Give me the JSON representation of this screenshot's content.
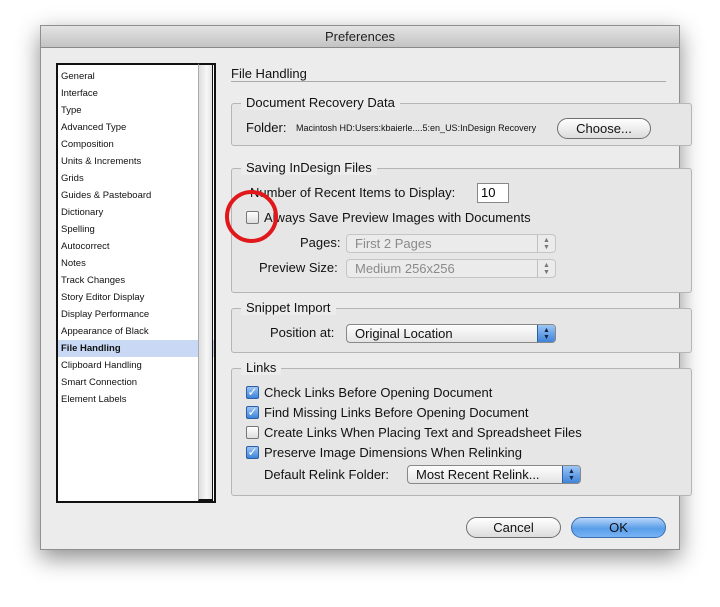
{
  "window": {
    "title": "Preferences"
  },
  "sidebar": {
    "items": [
      {
        "label": "General"
      },
      {
        "label": "Interface"
      },
      {
        "label": "Type"
      },
      {
        "label": "Advanced Type"
      },
      {
        "label": "Composition"
      },
      {
        "label": "Units & Increments"
      },
      {
        "label": "Grids"
      },
      {
        "label": "Guides & Pasteboard"
      },
      {
        "label": "Dictionary"
      },
      {
        "label": "Spelling"
      },
      {
        "label": "Autocorrect"
      },
      {
        "label": "Notes"
      },
      {
        "label": "Track Changes"
      },
      {
        "label": "Story Editor Display"
      },
      {
        "label": "Display Performance"
      },
      {
        "label": "Appearance of Black"
      },
      {
        "label": "File Handling"
      },
      {
        "label": "Clipboard Handling"
      },
      {
        "label": "Smart Connection"
      },
      {
        "label": "Element Labels"
      }
    ],
    "selected": "File Handling"
  },
  "section_title": "File Handling",
  "recovery": {
    "label": "Document Recovery Data",
    "folder_label": "Folder:",
    "folder_path": "Macintosh HD:Users:kbaierle....5:en_US:InDesign Recovery",
    "choose_label": "Choose..."
  },
  "saving": {
    "label": "Saving InDesign Files",
    "recent_label": "Number of Recent Items to Display:",
    "recent_value": "10",
    "preview_label": "Always Save Preview Images with Documents",
    "preview_checked": false,
    "pages_label": "Pages:",
    "pages_value": "First 2 Pages",
    "size_label": "Preview Size:",
    "size_value": "Medium 256x256"
  },
  "snippet": {
    "label": "Snippet Import",
    "position_label": "Position at:",
    "position_value": "Original Location"
  },
  "links": {
    "label": "Links",
    "options": [
      {
        "label": "Check Links Before Opening Document",
        "checked": true
      },
      {
        "label": "Find Missing Links Before Opening Document",
        "checked": true
      },
      {
        "label": "Create Links When Placing Text and Spreadsheet Files",
        "checked": false
      },
      {
        "label": "Preserve Image Dimensions When Relinking",
        "checked": true
      }
    ],
    "relink_label": "Default Relink Folder:",
    "relink_value": "Most Recent Relink..."
  },
  "buttons": {
    "cancel": "Cancel",
    "ok": "OK"
  },
  "colors": {
    "highlight_circle": "#e1181b",
    "selection": "#c9d9f5",
    "accent": "#3f83d8"
  },
  "symbols": {
    "check": "✓",
    "arrows_up": "▲",
    "arrows_down": "▼"
  }
}
